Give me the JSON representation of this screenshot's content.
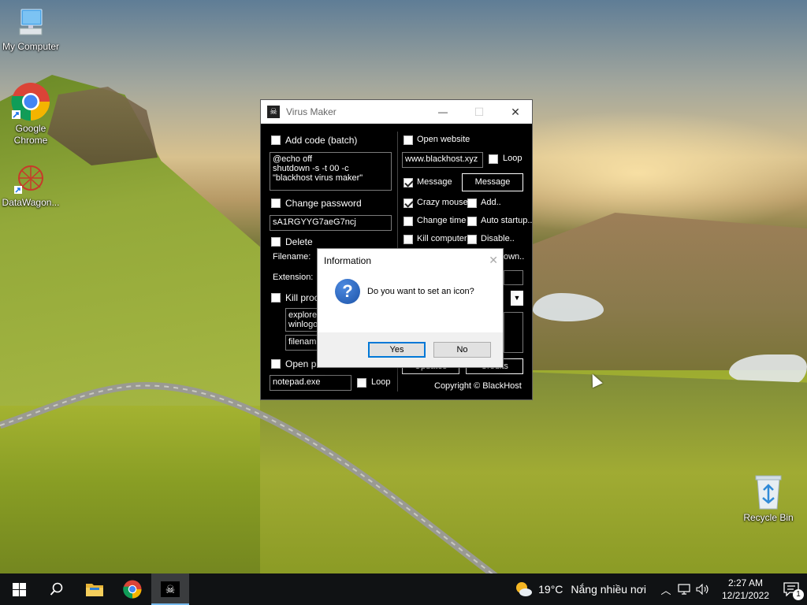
{
  "desktop": {
    "icons": [
      {
        "label": "My Computer",
        "icon": "computer-icon"
      },
      {
        "label": "Google Chrome",
        "icon": "chrome-icon"
      },
      {
        "label": "DataWagon...",
        "icon": "datawagon-icon"
      },
      {
        "label": "Recycle Bin",
        "icon": "recycle-bin-icon"
      }
    ]
  },
  "app": {
    "title": "Virus Maker",
    "icon": "pirate-flag-icon",
    "controls": {
      "minimize": "—",
      "maximize": "☐",
      "close": "✕"
    },
    "left": {
      "add_code_label": "Add code (batch)",
      "batch_code": "@echo off\nshutdown -s -t 00 -c \"blackhost virus maker\"",
      "change_password_label": "Change password",
      "password_value": "sA1RGYYG7aeG7ncj",
      "delete_label": "Delete",
      "filename_label": "Filename:",
      "extension_label": "Extension:",
      "kill_process_label": "Kill proce",
      "kill_list": "explorer\nwinlogo",
      "kill_filename": "filename",
      "open_program_label": "Open pro",
      "program_value": "notepad.exe",
      "loop_label": "Loop"
    },
    "right": {
      "open_website_label": "Open website",
      "website_value": "www.blackhost.xyz",
      "loop_label": "Loop",
      "message_label": "Message",
      "message_button": "Message",
      "crazy_mouse_label": "Crazy mouse",
      "add_label": "Add..",
      "change_time_label": "Change time",
      "auto_startup_label": "Auto startup..",
      "kill_computer_label": "Kill computer",
      "disable_label": "Disable..",
      "partial_label": "own..",
      "updates_button": "Updates",
      "credits_button": "Credits",
      "copyright": "Copyright © BlackHost"
    },
    "checks": {
      "add_code": false,
      "change_password": false,
      "delete": false,
      "kill_process": false,
      "open_program": false,
      "program_loop": false,
      "open_website": false,
      "website_loop": false,
      "message": true,
      "crazy_mouse": true,
      "add": false,
      "change_time": false,
      "auto_startup": false,
      "kill_computer": false,
      "disable": false
    }
  },
  "dialog": {
    "title": "Information",
    "close": "✕",
    "icon": "question-icon",
    "message": "Do you want to set an icon?",
    "yes_label": "Yes",
    "no_label": "No"
  },
  "taskbar": {
    "weather_temp": "19°C",
    "weather_text": "Nắng nhiều nơi",
    "time": "2:27 AM",
    "date": "12/21/2022",
    "notification_count": "1",
    "accent": "#0078d7"
  }
}
